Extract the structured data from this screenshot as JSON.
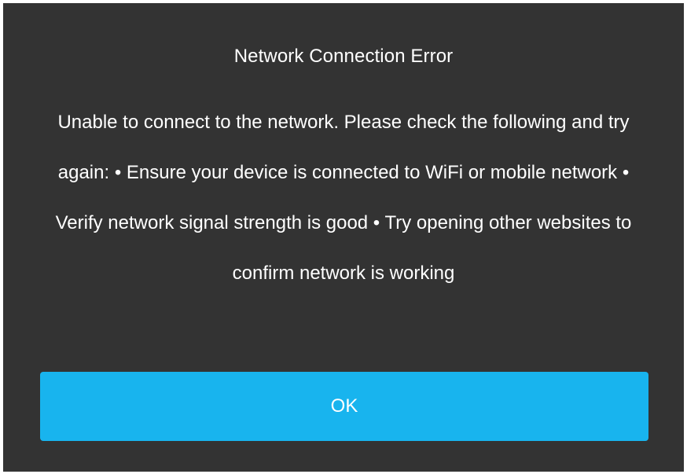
{
  "dialog": {
    "title": "Network Connection Error",
    "message": "Unable to connect to the network. Please check the following and try again: • Ensure your device is connected to WiFi or mobile network • Verify network signal strength is good • Try opening other websites to confirm network is working",
    "ok_label": "OK"
  },
  "colors": {
    "dialog_background": "#333333",
    "button_background": "#18b4ee",
    "text": "#ffffff"
  }
}
